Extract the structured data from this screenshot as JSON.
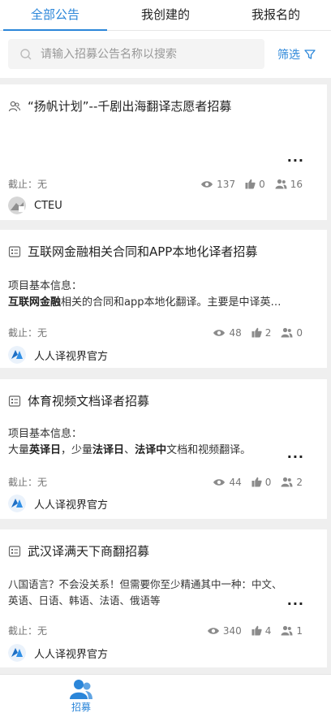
{
  "tabs": [
    "全部公告",
    "我创建的",
    "我报名的"
  ],
  "search": {
    "placeholder": "请输入招募公告名称以搜索"
  },
  "filter_label": "筛选",
  "cards": [
    {
      "title": "“扬帆计划”--千剧出海翻译志愿者招募",
      "deadline": "截止：无",
      "views": "137",
      "likes": "0",
      "members": "16",
      "author": "CTEU"
    },
    {
      "title": "互联网金融相关合同和APP本地化译者招募",
      "body_label": "项目基本信息：",
      "body_bold": "互联网金融",
      "body_rest": "相关的合同和app本地化翻译。主要是中译英…",
      "deadline": "截止：无",
      "views": "48",
      "likes": "2",
      "members": "0",
      "author": "人人译视界官方"
    },
    {
      "title": "体育视频文档译者招募",
      "body_label": "项目基本信息：",
      "body_parts": [
        "大量",
        "英译日",
        "，少量",
        "法译日",
        "、",
        "法译中",
        "文档和视频翻译。"
      ],
      "deadline": "截止：无",
      "views": "44",
      "likes": "0",
      "members": "2",
      "author": "人人译视界官方"
    },
    {
      "title": "武汉译满天下商翻招募",
      "body_line1": "八国语言？不会没关系！但需要你至少精通其中一种：中文、",
      "body_line2": "英语、日语、韩语、法语、俄语等",
      "deadline": "截止：无",
      "views": "340",
      "likes": "4",
      "members": "1",
      "author": "人人译视界官方"
    }
  ],
  "more_label": "...",
  "bottom_nav": {
    "label": "招募"
  },
  "colors": {
    "accent": "#2b86d9"
  }
}
